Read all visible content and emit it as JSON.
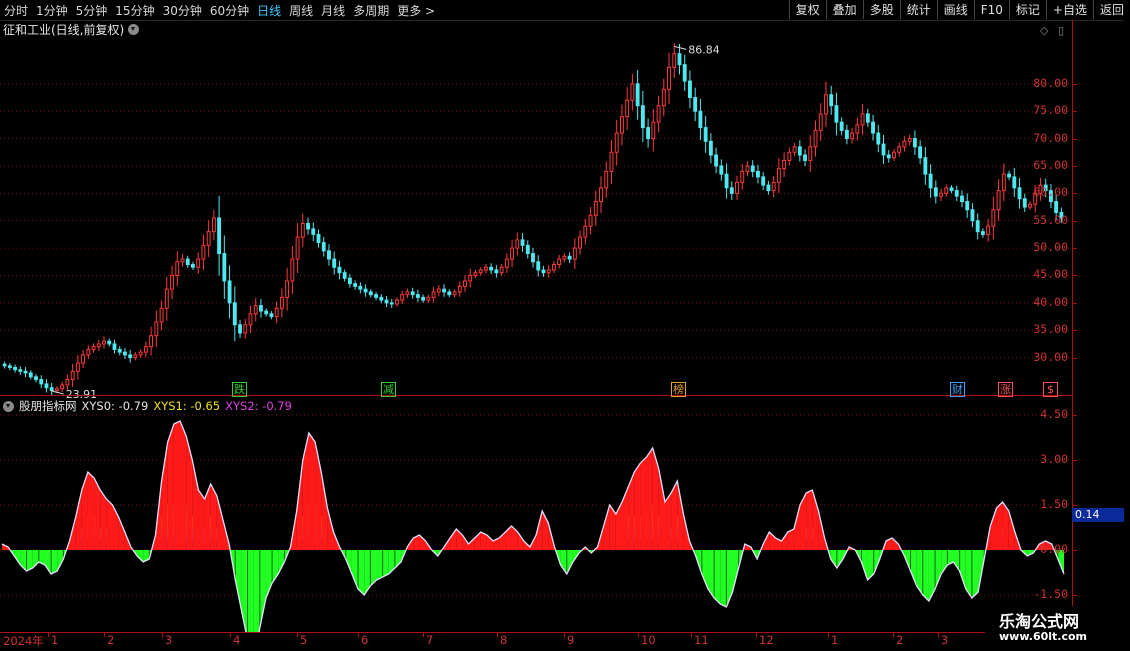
{
  "toolbar": {
    "periods": [
      "分时",
      "1分钟",
      "5分钟",
      "15分钟",
      "30分钟",
      "60分钟",
      "日线",
      "周线",
      "月线",
      "多周期",
      "更多 >"
    ],
    "active_period": "日线",
    "actions": [
      "复权",
      "叠加",
      "多股",
      "统计",
      "画线",
      "F10",
      "标记",
      "+自选",
      "返回"
    ]
  },
  "stock": {
    "title": "征和工业(日线,前复权)",
    "high_label": "86.84",
    "low_label": "23.91"
  },
  "price_axis": [
    "80.00",
    "75.00",
    "70.00",
    "65.00",
    "60.00",
    "55.00",
    "50.00",
    "45.00",
    "40.00",
    "35.00",
    "30.00"
  ],
  "event_markers": [
    {
      "text": "跌",
      "color": "#30d030"
    },
    {
      "text": "减",
      "color": "#30d030"
    },
    {
      "text": "榜",
      "color": "#e0a030"
    },
    {
      "text": "财",
      "color": "#39a0ff"
    },
    {
      "text": "涨",
      "color": "#ff5050"
    },
    {
      "text": "$",
      "color": "#ff5050"
    }
  ],
  "indicator": {
    "name": "股朋指标网",
    "xys0": "XYS0: -0.79",
    "xys1": "XYS1: -0.65",
    "xys2": "XYS2: -0.79",
    "axis": [
      "4.50",
      "3.00",
      "1.50",
      "0.00",
      "-1.50"
    ],
    "current_value": "0.14"
  },
  "time_axis": {
    "year": "2024年",
    "months": [
      "1",
      "2",
      "3",
      "4",
      "5",
      "6",
      "7",
      "8",
      "9",
      "10",
      "11",
      "12",
      "1",
      "2",
      "3"
    ]
  },
  "watermark": {
    "line1": "乐淘公式网",
    "line2": "www.60lt.com"
  },
  "chart_data": [
    {
      "type": "candlestick",
      "title": "征和工业(日线,前复权)",
      "ylim": [
        25,
        88
      ],
      "high": 86.84,
      "low": 23.91,
      "close_series": [
        28.5,
        28.2,
        27.8,
        27.5,
        27.2,
        26.5,
        26.0,
        25.2,
        24.5,
        24.0,
        24.3,
        25.0,
        26.0,
        27.5,
        29.0,
        30.5,
        31.5,
        32.0,
        32.5,
        33.0,
        32.5,
        31.5,
        31.0,
        30.5,
        30.0,
        30.5,
        31.0,
        32.0,
        34.0,
        36.5,
        39.0,
        42.5,
        45.0,
        47.5,
        48.0,
        47.0,
        46.5,
        48.0,
        50.5,
        53.0,
        55.5,
        49.0,
        44.0,
        40.0,
        36.0,
        34.5,
        36.0,
        38.0,
        39.5,
        38.5,
        38.0,
        37.5,
        39.0,
        41.0,
        44.0,
        48.0,
        52.0,
        54.5,
        53.5,
        52.5,
        51.0,
        49.5,
        48.0,
        46.5,
        45.5,
        44.5,
        43.5,
        43.0,
        42.5,
        42.0,
        41.5,
        41.0,
        40.5,
        40.0,
        39.8,
        40.5,
        41.5,
        42.0,
        41.5,
        41.0,
        40.5,
        41.0,
        42.0,
        42.5,
        42.0,
        41.5,
        42.0,
        43.0,
        44.0,
        45.0,
        45.5,
        46.0,
        46.5,
        46.0,
        45.5,
        46.5,
        48.0,
        50.0,
        51.5,
        50.5,
        49.0,
        47.5,
        46.0,
        45.5,
        46.0,
        47.0,
        48.0,
        48.5,
        48.0,
        50.0,
        52.0,
        54.0,
        56.0,
        58.5,
        61.0,
        64.0,
        67.5,
        71.0,
        74.0,
        77.0,
        80.0,
        76.0,
        72.0,
        70.0,
        73.0,
        76.0,
        79.0,
        83.0,
        85.5,
        83.5,
        80.5,
        77.5,
        75.0,
        72.0,
        69.5,
        67.0,
        65.0,
        63.5,
        61.0,
        60.0,
        62.0,
        64.0,
        65.0,
        64.0,
        63.0,
        61.5,
        60.5,
        62.0,
        64.5,
        66.0,
        67.5,
        68.5,
        67.0,
        66.0,
        68.5,
        71.5,
        74.5,
        78.0,
        76.0,
        73.0,
        71.5,
        70.0,
        71.0,
        72.5,
        74.5,
        73.0,
        71.0,
        69.0,
        67.0,
        66.5,
        67.5,
        68.5,
        69.5,
        70.0,
        68.5,
        66.5,
        63.5,
        61.0,
        59.5,
        60.0,
        61.0,
        60.5,
        59.5,
        58.5,
        57.0,
        55.0,
        53.0,
        52.5,
        54.0,
        57.0,
        60.5,
        63.5,
        63.0,
        61.0,
        59.0,
        57.5,
        58.0,
        60.0,
        61.5,
        60.5,
        58.5,
        56.5,
        55.5
      ],
      "price_axis_labels": [
        "80.00",
        "75.00",
        "70.00",
        "65.00",
        "60.00",
        "55.00",
        "50.00",
        "45.00",
        "40.00",
        "35.00",
        "30.00"
      ]
    },
    {
      "type": "area",
      "title": "股朋指标网",
      "ylim": [
        -2.6,
        5.0
      ],
      "axis_labels": [
        "4.50",
        "3.00",
        "1.50",
        "0.00",
        "-1.50"
      ],
      "values": [
        0.2,
        0.1,
        -0.2,
        -0.5,
        -0.7,
        -0.6,
        -0.4,
        -0.5,
        -0.8,
        -0.7,
        -0.3,
        0.3,
        1.1,
        2.0,
        2.6,
        2.4,
        2.0,
        1.7,
        1.5,
        1.1,
        0.6,
        0.1,
        -0.2,
        -0.4,
        -0.3,
        0.5,
        2.3,
        3.6,
        4.2,
        4.3,
        3.8,
        3.0,
        2.0,
        1.7,
        2.2,
        1.8,
        1.0,
        0.2,
        -1.0,
        -2.0,
        -3.0,
        -3.8,
        -2.6,
        -1.6,
        -1.1,
        -0.8,
        -0.4,
        0.1,
        1.3,
        3.0,
        3.9,
        3.6,
        2.6,
        1.4,
        0.6,
        0.1,
        -0.3,
        -0.8,
        -1.3,
        -1.5,
        -1.2,
        -1.0,
        -0.9,
        -0.8,
        -0.6,
        -0.4,
        0.1,
        0.4,
        0.5,
        0.3,
        0.0,
        -0.2,
        0.1,
        0.4,
        0.7,
        0.5,
        0.2,
        0.4,
        0.6,
        0.5,
        0.3,
        0.4,
        0.6,
        0.8,
        0.6,
        0.3,
        0.1,
        0.5,
        1.3,
        0.9,
        0.1,
        -0.5,
        -0.8,
        -0.4,
        -0.1,
        0.1,
        -0.1,
        0.1,
        0.8,
        1.5,
        1.2,
        1.6,
        2.1,
        2.6,
        2.9,
        3.1,
        3.4,
        2.7,
        1.6,
        1.9,
        2.3,
        1.2,
        0.3,
        -0.2,
        -0.8,
        -1.3,
        -1.6,
        -1.8,
        -1.9,
        -1.4,
        -0.6,
        0.2,
        0.1,
        -0.3,
        0.2,
        0.6,
        0.4,
        0.3,
        0.6,
        0.7,
        1.5,
        1.9,
        2.0,
        1.3,
        0.4,
        -0.3,
        -0.6,
        -0.3,
        0.1,
        0.0,
        -0.4,
        -1.0,
        -0.8,
        -0.3,
        0.3,
        0.4,
        0.2,
        -0.2,
        -0.7,
        -1.2,
        -1.5,
        -1.7,
        -1.3,
        -0.8,
        -0.5,
        -0.4,
        -0.7,
        -1.3,
        -1.6,
        -1.4,
        -0.3,
        0.8,
        1.4,
        1.6,
        1.3,
        0.6,
        0.0,
        -0.2,
        -0.1,
        0.2,
        0.3,
        0.2,
        -0.3,
        -0.8
      ]
    }
  ]
}
